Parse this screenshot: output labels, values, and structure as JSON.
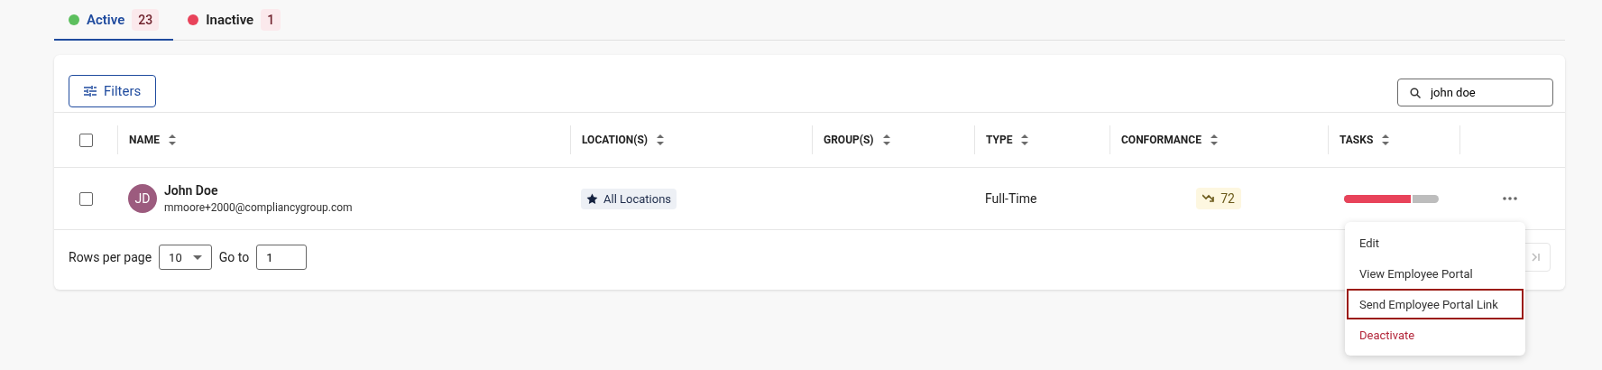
{
  "tabs": [
    {
      "label": "Active",
      "count": "23",
      "color": "#5cbf5e",
      "selected": true
    },
    {
      "label": "Inactive",
      "count": "1",
      "color": "#e8435a",
      "selected": false
    }
  ],
  "toolbar": {
    "filters_label": "Filters",
    "search": {
      "value": "john doe"
    }
  },
  "table": {
    "select_all_checked": false,
    "columns": [
      {
        "label": "NAME"
      },
      {
        "label": "LOCATION(S)"
      },
      {
        "label": "GROUP(S)"
      },
      {
        "label": "TYPE"
      },
      {
        "label": "CONFORMANCE"
      },
      {
        "label": "TASKS"
      }
    ],
    "rows": [
      {
        "checked": false,
        "initials": "JD",
        "name": "John Doe",
        "email": "mmoore+2000@compliancygroup.com",
        "location": "All Locations",
        "type": "Full-Time",
        "conformance": "72",
        "tasks": {
          "level": 0.7
        }
      }
    ]
  },
  "pagination": {
    "rows_per_page_label": "Rows per page",
    "rows_per_page": "10",
    "go_to_label": "Go to",
    "go_to_value": "1"
  },
  "menu": {
    "items": [
      {
        "label": "Edit",
        "kind": "normal",
        "selected": false
      },
      {
        "label": "View Employee Portal",
        "kind": "normal",
        "selected": false
      },
      {
        "label": "Send Employee Portal Link",
        "kind": "normal",
        "selected": true
      },
      {
        "label": "Deactivate",
        "kind": "danger",
        "selected": false
      }
    ]
  }
}
